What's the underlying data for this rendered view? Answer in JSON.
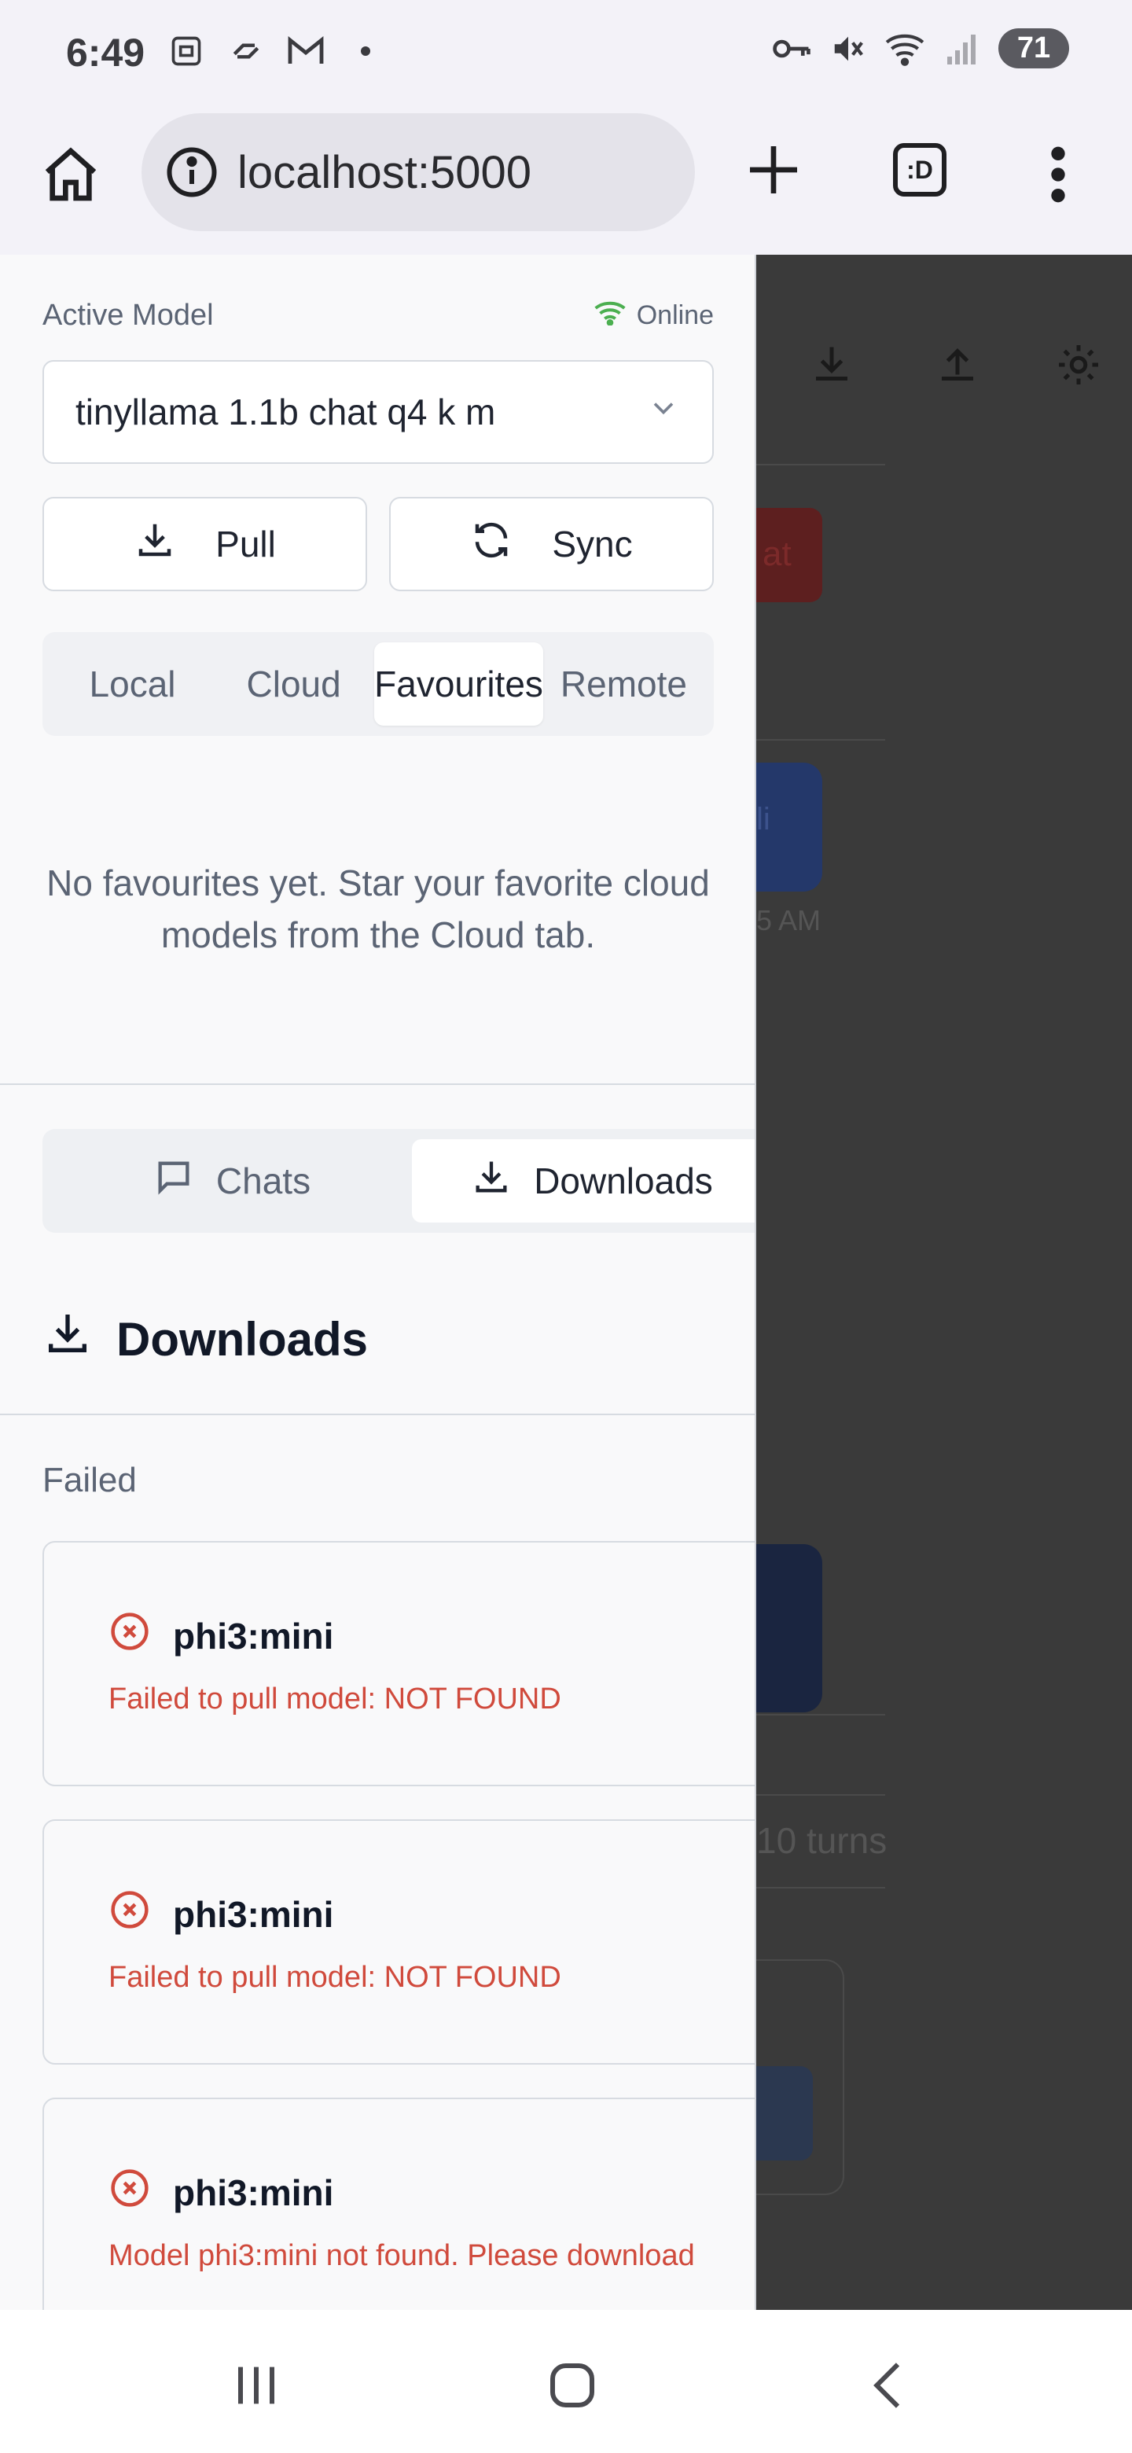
{
  "status_bar": {
    "time": "6:49",
    "battery": "71",
    "left_icons": [
      "screenshot-icon",
      "link-icon",
      "gmail-icon",
      "dot-icon"
    ],
    "right_icons": [
      "key-icon",
      "mute-icon",
      "wifi-icon",
      "signal-icon"
    ]
  },
  "browser": {
    "url": "localhost:5000",
    "tabs_label": ":D"
  },
  "sidebar": {
    "active_model_label": "Active Model",
    "status": "Online",
    "selected_model": "tinyllama 1.1b chat q4 k m",
    "pull_label": "Pull",
    "sync_label": "Sync",
    "model_tabs": [
      {
        "label": "Local",
        "active": false
      },
      {
        "label": "Cloud",
        "active": false
      },
      {
        "label": "Favourites",
        "active": true
      },
      {
        "label": "Remote",
        "active": false
      }
    ],
    "empty_message": "No favourites yet. Star your favorite cloud models from the Cloud tab.",
    "view_tabs": [
      {
        "label": "Chats",
        "active": false
      },
      {
        "label": "Downloads",
        "active": true
      }
    ],
    "section_title": "Downloads",
    "failed_label": "Failed",
    "downloads": [
      {
        "name": "phi3:mini",
        "message": "Failed to pull model: NOT FOUND"
      },
      {
        "name": "phi3:mini",
        "message": "Failed to pull model: NOT FOUND"
      },
      {
        "name": "phi3:mini",
        "message": "Model phi3:mini not found. Please download"
      }
    ]
  },
  "background": {
    "red_button_text": "at",
    "blue_bubble_text": "li",
    "time_fragment": "5 AM",
    "turns_text": "10 turns"
  },
  "colors": {
    "online": "#4caf50",
    "error": "#d04a3c",
    "overlay": "#3a3a3a"
  }
}
